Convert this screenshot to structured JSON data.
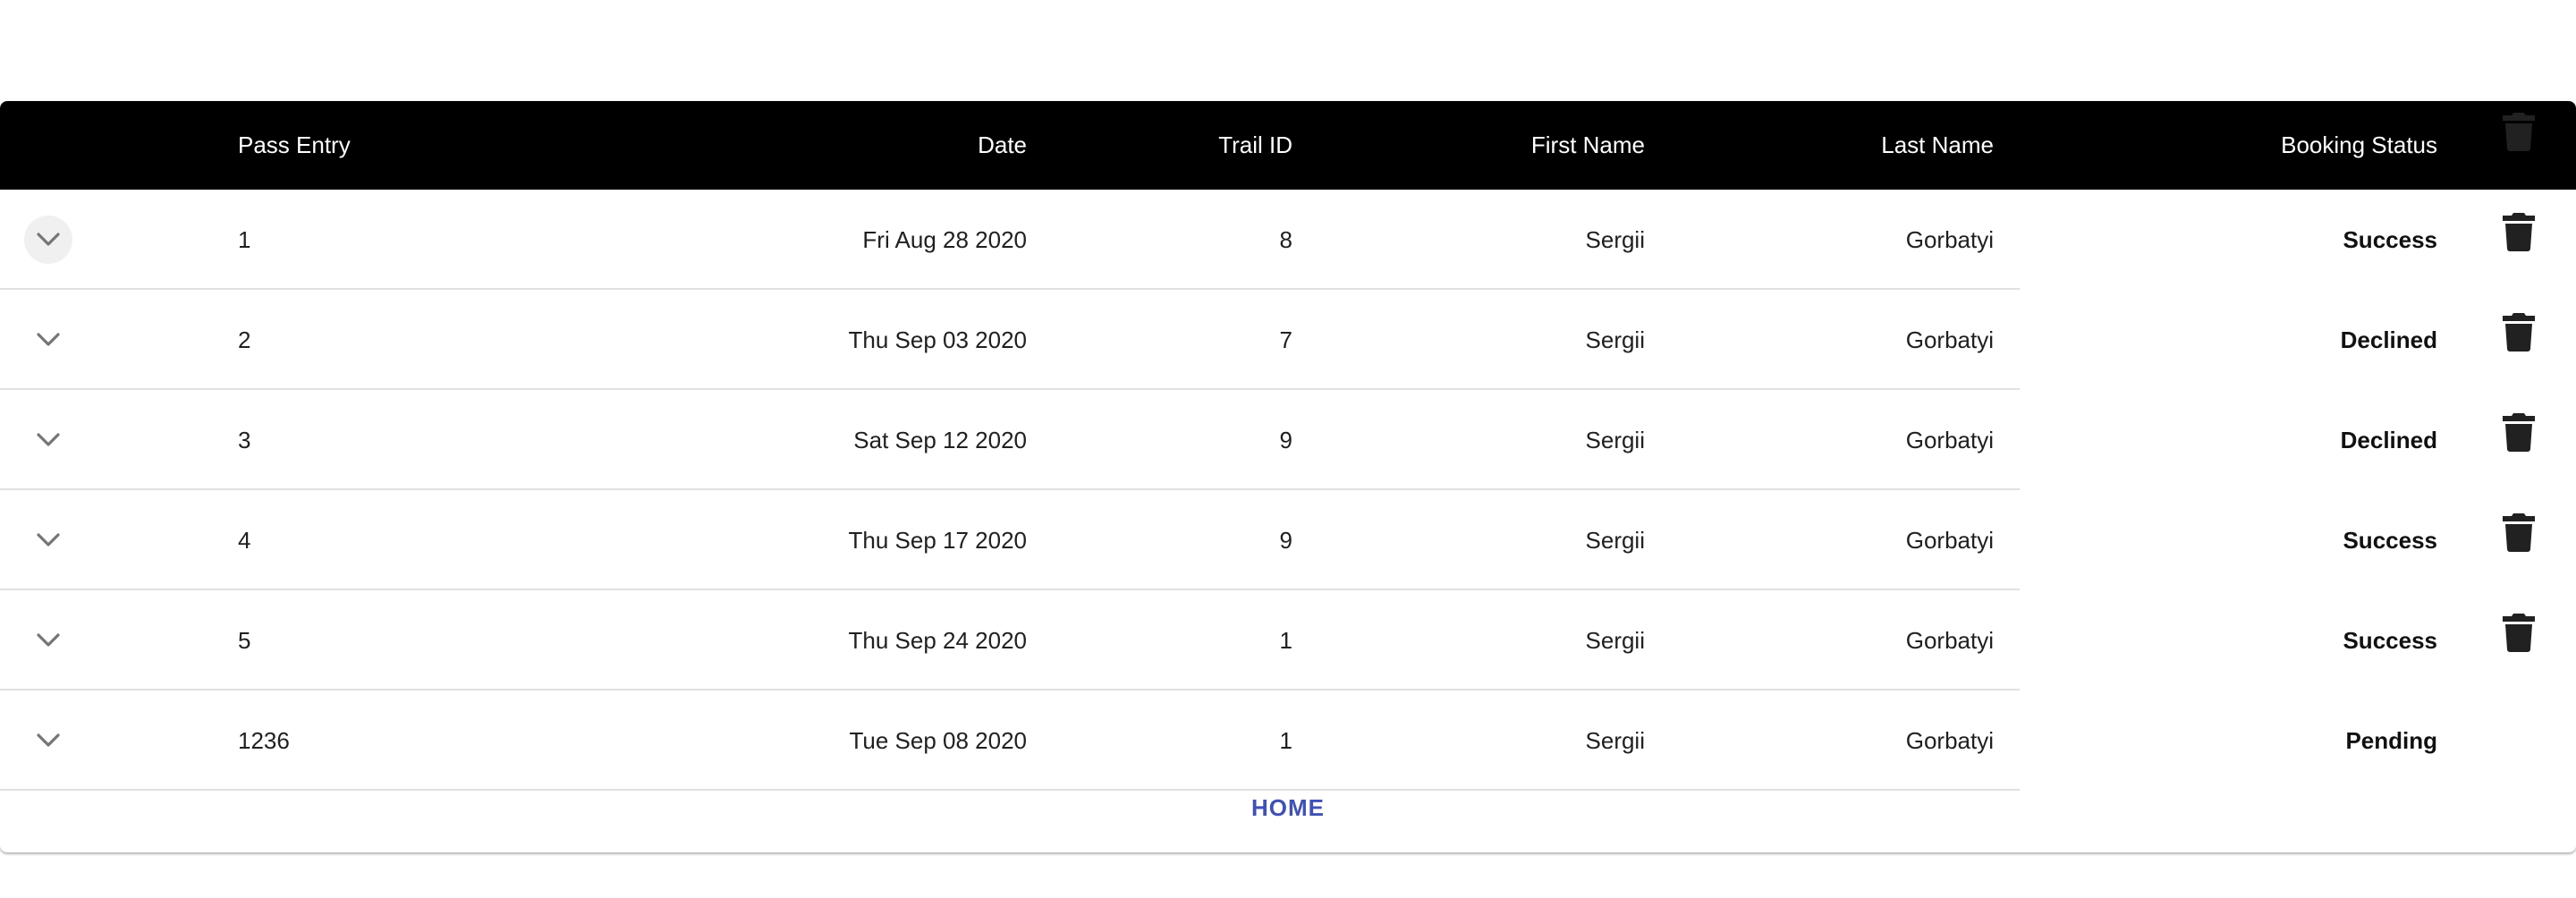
{
  "table": {
    "columns": {
      "pass_entry": "Pass Entry",
      "date": "Date",
      "trail_id": "Trail ID",
      "first_name": "First Name",
      "last_name": "Last Name",
      "booking_status": "Booking Status"
    },
    "rows": [
      {
        "pass_entry": "1",
        "date": "Fri Aug 28 2020",
        "trail_id": "8",
        "first_name": "Sergii",
        "last_name": "Gorbatyi",
        "status": "Success"
      },
      {
        "pass_entry": "2",
        "date": "Thu Sep 03 2020",
        "trail_id": "7",
        "first_name": "Sergii",
        "last_name": "Gorbatyi",
        "status": "Declined"
      },
      {
        "pass_entry": "3",
        "date": "Sat Sep 12 2020",
        "trail_id": "9",
        "first_name": "Sergii",
        "last_name": "Gorbatyi",
        "status": "Declined"
      },
      {
        "pass_entry": "4",
        "date": "Thu Sep 17 2020",
        "trail_id": "9",
        "first_name": "Sergii",
        "last_name": "Gorbatyi",
        "status": "Success"
      },
      {
        "pass_entry": "5",
        "date": "Thu Sep 24 2020",
        "trail_id": "1",
        "first_name": "Sergii",
        "last_name": "Gorbatyi",
        "status": "Success"
      },
      {
        "pass_entry": "1236",
        "date": "Tue Sep 08 2020",
        "trail_id": "1",
        "first_name": "Sergii",
        "last_name": "Gorbatyi",
        "status": "Pending"
      }
    ],
    "row_icons": {
      "expand": "chevron-down-icon",
      "delete": "trash-icon"
    }
  },
  "footer": {
    "home_label": "HOME"
  },
  "colors": {
    "header_bg": "#000000",
    "header_text": "#ffffff",
    "link": "#3f51b5",
    "icon": "#757575",
    "trash": "#212121"
  }
}
